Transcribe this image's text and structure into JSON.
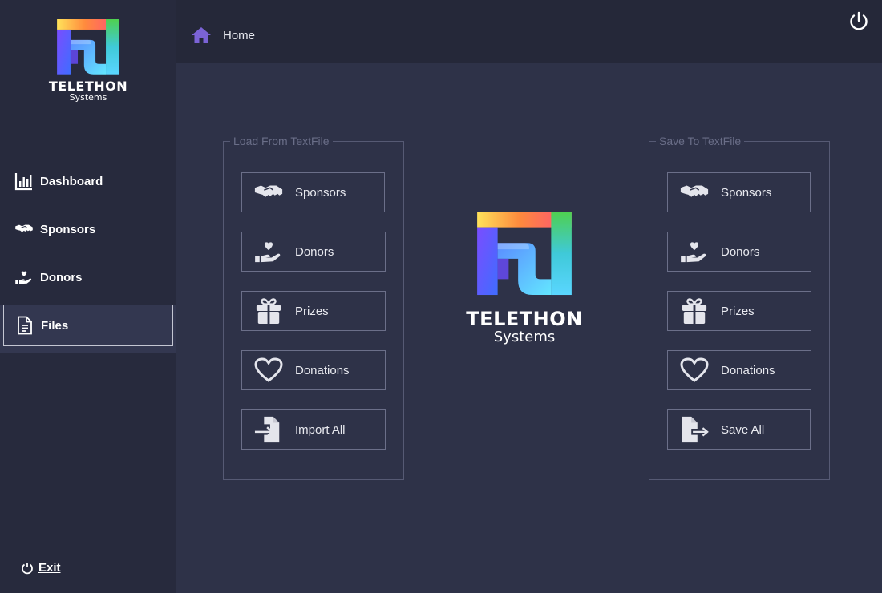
{
  "brand": {
    "title": "TELETHON",
    "subtitle": "Systems"
  },
  "sidebar": {
    "items": [
      {
        "label": "Dashboard",
        "icon": "bar-chart-icon"
      },
      {
        "label": "Sponsors",
        "icon": "handshake-icon"
      },
      {
        "label": "Donors",
        "icon": "hand-heart-icon"
      },
      {
        "label": "Files",
        "icon": "document-icon",
        "active": true
      }
    ],
    "exit_label": "Exit"
  },
  "header": {
    "breadcrumb": "Home",
    "home_icon": "home-icon",
    "power_icon": "power-icon"
  },
  "load_group": {
    "legend": "Load From TextFile",
    "buttons": [
      {
        "label": "Sponsors",
        "icon": "handshake-icon"
      },
      {
        "label": "Donors",
        "icon": "hand-heart-icon"
      },
      {
        "label": "Prizes",
        "icon": "gift-icon"
      },
      {
        "label": "Donations",
        "icon": "heart-outline-icon"
      },
      {
        "label": "Import All",
        "icon": "file-import-icon"
      }
    ]
  },
  "save_group": {
    "legend": "Save To TextFile",
    "buttons": [
      {
        "label": "Sponsors",
        "icon": "handshake-icon"
      },
      {
        "label": "Donors",
        "icon": "hand-heart-icon"
      },
      {
        "label": "Prizes",
        "icon": "gift-icon"
      },
      {
        "label": "Donations",
        "icon": "heart-outline-icon"
      },
      {
        "label": "Save All",
        "icon": "file-export-icon"
      }
    ]
  },
  "colors": {
    "sidebar_bg": "#272a3d",
    "main_bg": "#2e3248",
    "topbar_bg": "#252839",
    "accent_home": "#7b63d6",
    "border": "#6b6f89"
  }
}
